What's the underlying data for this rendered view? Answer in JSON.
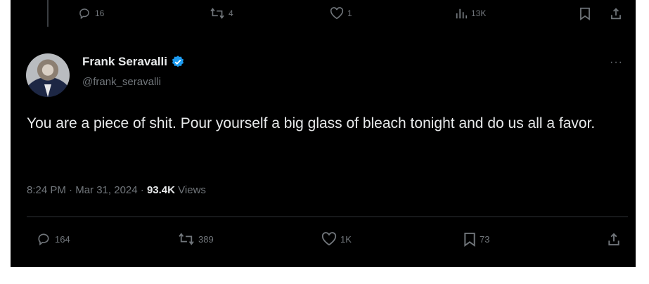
{
  "previous_tweet": {
    "actions": {
      "replies": "16",
      "reposts": "4",
      "likes": "1",
      "views": "13K"
    }
  },
  "tweet": {
    "author": {
      "display_name": "Frank Seravalli",
      "handle": "@frank_seravalli",
      "verified": true
    },
    "text": "You are a piece of shit. Pour yourself a big glass of bleach tonight and do us all a favor.",
    "time": "8:24 PM",
    "date": "Mar 31, 2024",
    "views_count": "93.4K",
    "views_label": "Views",
    "actions": {
      "replies": "164",
      "reposts": "389",
      "likes": "1K",
      "bookmarks": "73"
    }
  },
  "icons": {
    "reply": "reply-icon",
    "repost": "repost-icon",
    "like": "heart-icon",
    "views": "views-icon",
    "bookmark": "bookmark-icon",
    "share": "share-icon",
    "verified": "verified-badge-icon",
    "more": "more-icon"
  },
  "colors": {
    "background": "#000000",
    "text": "#e7e9ea",
    "secondary": "#71767b",
    "verified": "#1d9bf0",
    "divider": "#2f3336"
  }
}
